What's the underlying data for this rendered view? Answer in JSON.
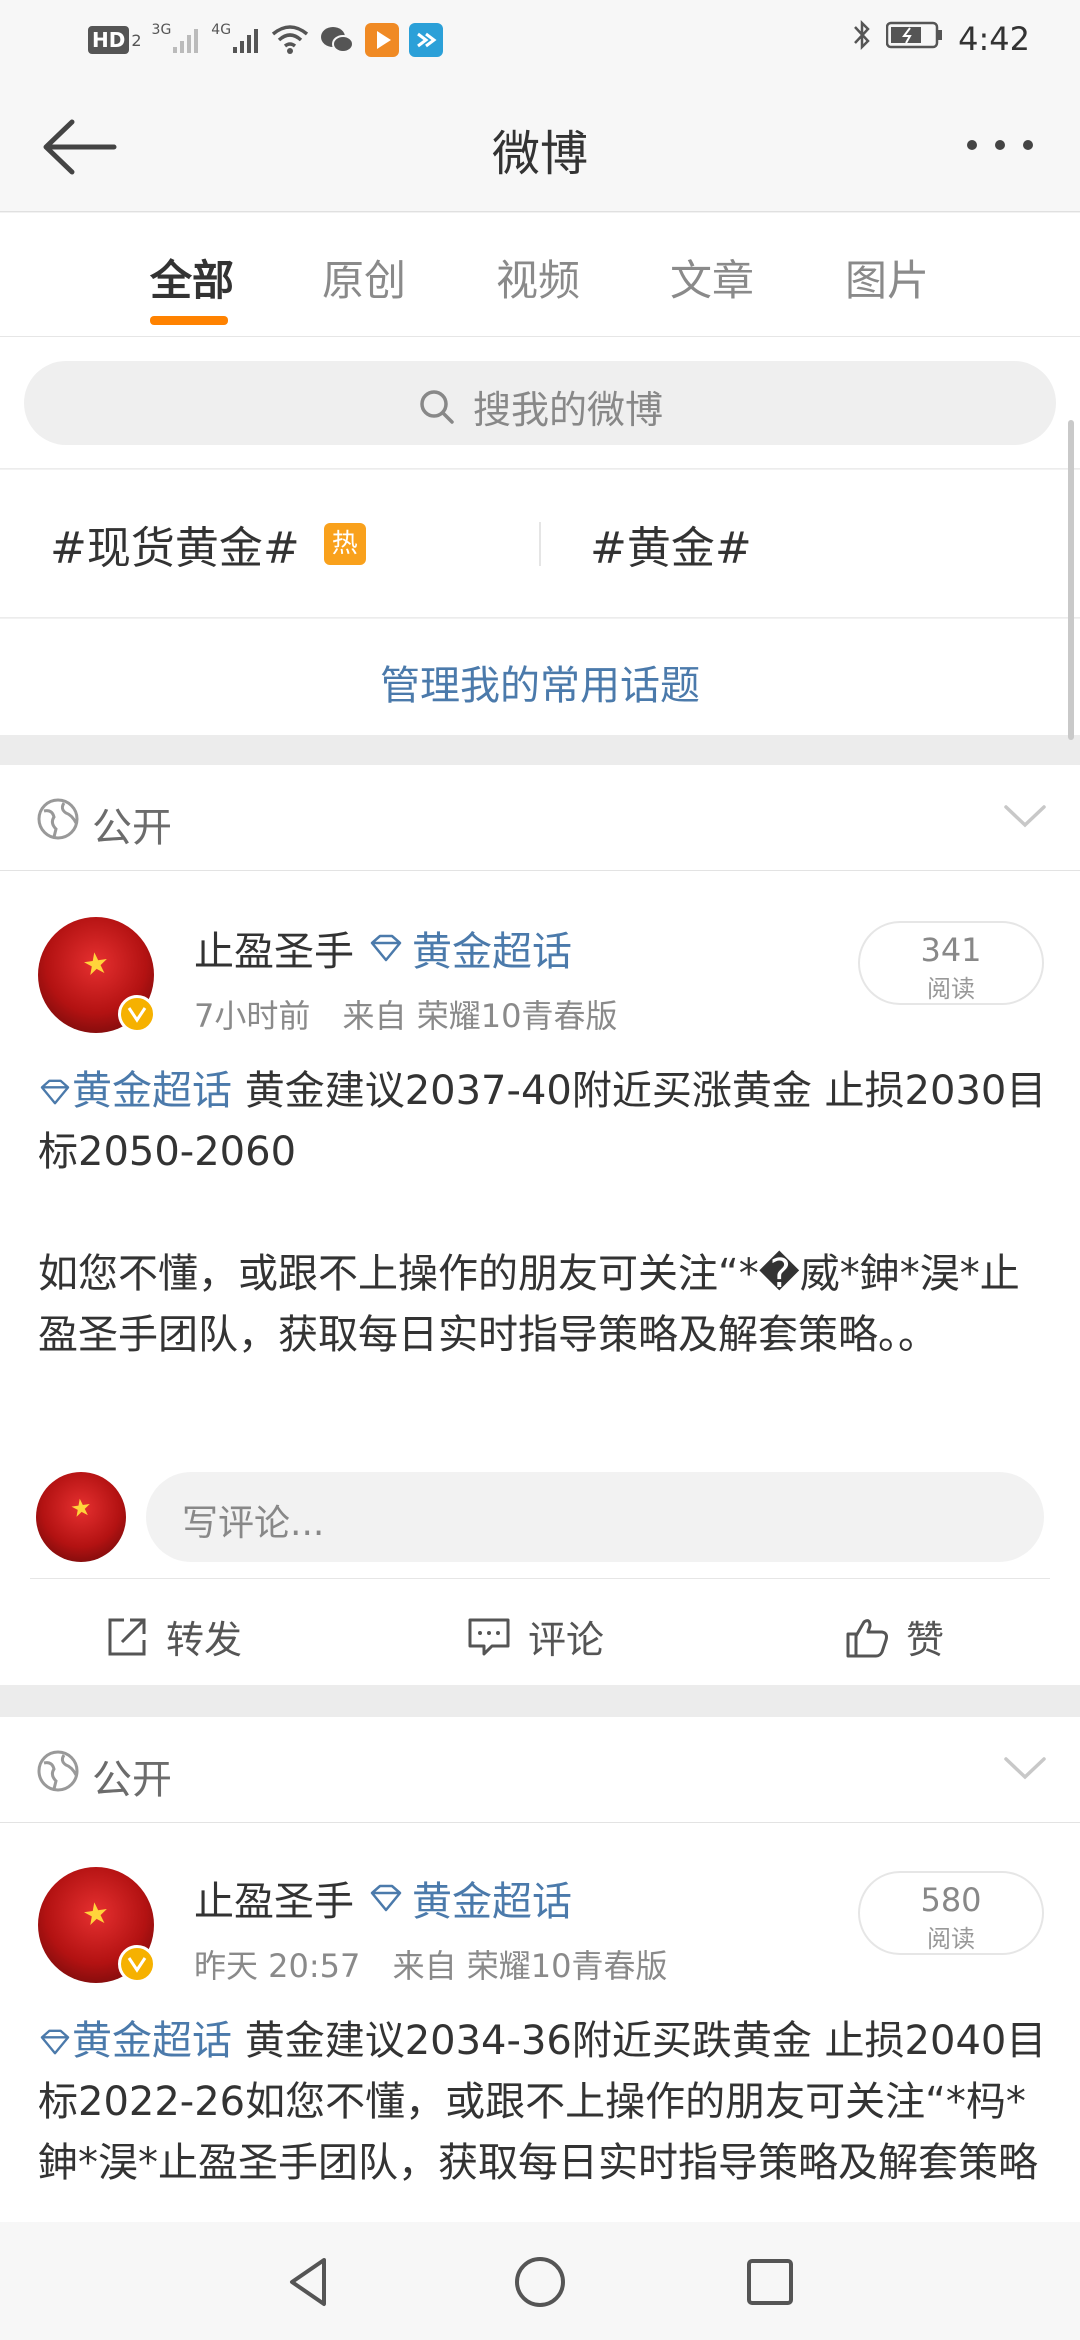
{
  "status_bar": {
    "hd_label": "HD",
    "hd_sub": "2",
    "net_3g": "3G",
    "net_4g": "4G",
    "time": "4:42"
  },
  "header": {
    "title": "微博"
  },
  "tabs": [
    {
      "label": "全部",
      "active": true
    },
    {
      "label": "原创",
      "active": false
    },
    {
      "label": "视频",
      "active": false
    },
    {
      "label": "文章",
      "active": false
    },
    {
      "label": "图片",
      "active": false
    }
  ],
  "search": {
    "placeholder": "搜我的微博"
  },
  "topics": [
    {
      "label": "#现货黄金#",
      "badge": "热"
    },
    {
      "label": "#黄金#"
    }
  ],
  "manage_topics_label": "管理我的常用话题",
  "posts": [
    {
      "visibility": "公开",
      "username": "止盈圣手",
      "supertopic": "黄金超话",
      "time": "7小时前",
      "source": "来自 荣耀10青春版",
      "reads_count": "341",
      "reads_label": "阅读",
      "text_tag": "黄金超话",
      "text_line1": " 黄金建议2037-40附近买涨黄金 止损2030目标2050-2060",
      "text_line2": "如您不懂，或跟不上操作的朋友可关注“*�威*鉮*淏*止盈圣手团队，获取每日实时指导策略及解套策略。。",
      "comment_placeholder": "写评论...",
      "actions": {
        "repost": "转发",
        "comment": "评论",
        "like": "赞"
      }
    },
    {
      "visibility": "公开",
      "username": "止盈圣手",
      "supertopic": "黄金超话",
      "time": "昨天 20:57",
      "source": "来自 荣耀10青春版",
      "reads_count": "580",
      "reads_label": "阅读",
      "text_tag": "黄金超话",
      "text_line1": " 黄金建议2034-36附近买跌黄金 止损2040目标2022-26如您不懂，或跟不上操作的朋友可关注“*杩*鉮*淏*止盈圣手团队，获取每日实时指导策略及解套策略"
    }
  ],
  "colors": {
    "accent_orange": "#ff8200",
    "link_blue": "#4b7aab",
    "hot_badge": "#f9a11c",
    "verify_badge": "#f6b100"
  },
  "icons": [
    "back-arrow-icon",
    "more-dots-icon",
    "search-icon",
    "globe-icon",
    "chevron-down-icon",
    "diamond-icon",
    "repost-icon",
    "comment-icon",
    "like-icon",
    "nav-back-icon",
    "nav-home-icon",
    "nav-recent-icon"
  ]
}
